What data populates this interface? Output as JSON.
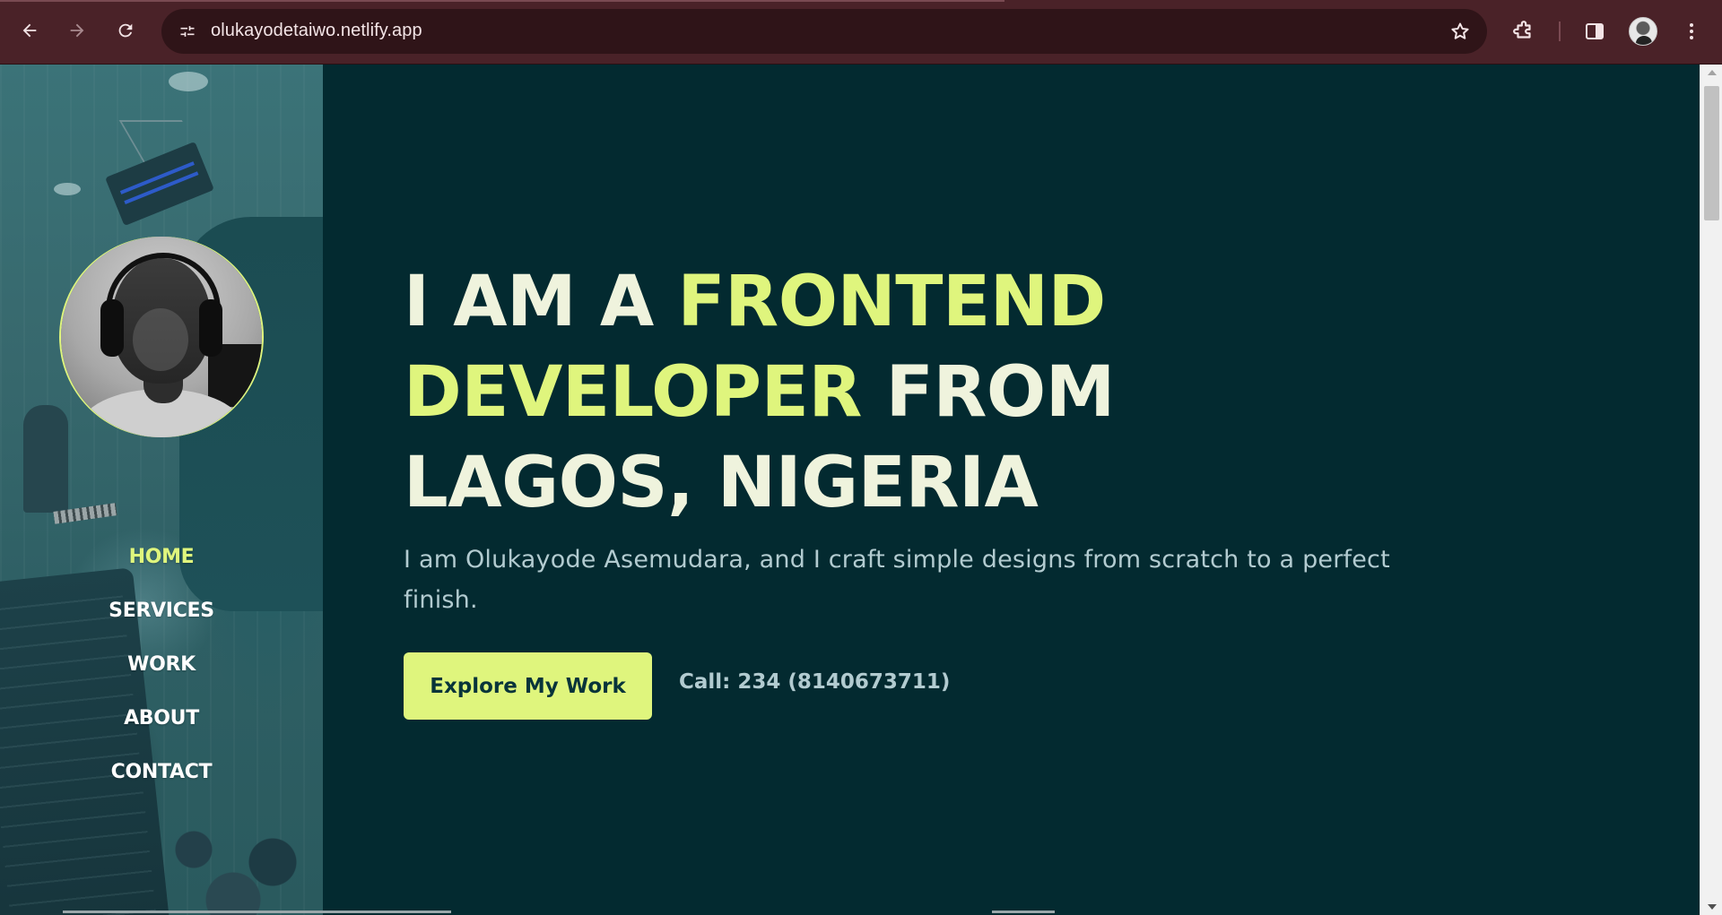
{
  "browser": {
    "url": "olukayodetaiwo.netlify.app",
    "icons": {
      "back": "arrow-left-icon",
      "forward": "arrow-right-icon",
      "reload": "reload-icon",
      "site_info": "tune-icon",
      "bookmark": "star-icon",
      "extensions": "puzzle-icon",
      "side_panel": "side-panel-icon",
      "profile": "avatar-icon",
      "menu": "kebab-menu-icon"
    }
  },
  "sidebar": {
    "nav": [
      {
        "label": "HOME",
        "active": true
      },
      {
        "label": "SERVICES",
        "active": false
      },
      {
        "label": "WORK",
        "active": false
      },
      {
        "label": "ABOUT",
        "active": false
      },
      {
        "label": "CONTACT",
        "active": false
      }
    ]
  },
  "hero": {
    "title_part1": "I AM A ",
    "title_highlight": "FRONTEND DEVELOPER",
    "title_part2": " FROM LAGOS, NIGERIA",
    "subtitle": "I am Olukayode Asemudara, and I craft simple designs from scratch to a perfect finish.",
    "cta_label": "Explore My Work",
    "call_text": "Call: 234 (8140673711)"
  },
  "colors": {
    "accent": "#dff57d",
    "background": "#032a30",
    "heading": "#eff3dd",
    "muted": "#b2cbd0",
    "browser_chrome": "#4a2228"
  }
}
